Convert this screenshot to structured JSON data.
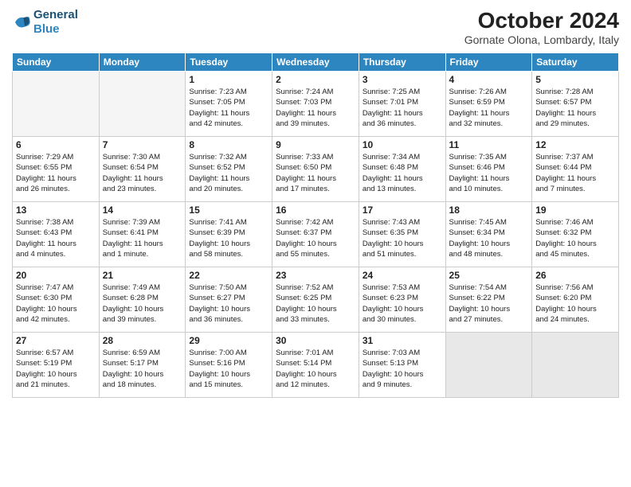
{
  "header": {
    "logo_line1": "General",
    "logo_line2": "Blue",
    "month": "October 2024",
    "location": "Gornate Olona, Lombardy, Italy"
  },
  "weekdays": [
    "Sunday",
    "Monday",
    "Tuesday",
    "Wednesday",
    "Thursday",
    "Friday",
    "Saturday"
  ],
  "weeks": [
    [
      {
        "day": "",
        "info": "",
        "empty": true
      },
      {
        "day": "",
        "info": "",
        "empty": true
      },
      {
        "day": "1",
        "info": "Sunrise: 7:23 AM\nSunset: 7:05 PM\nDaylight: 11 hours\nand 42 minutes."
      },
      {
        "day": "2",
        "info": "Sunrise: 7:24 AM\nSunset: 7:03 PM\nDaylight: 11 hours\nand 39 minutes."
      },
      {
        "day": "3",
        "info": "Sunrise: 7:25 AM\nSunset: 7:01 PM\nDaylight: 11 hours\nand 36 minutes."
      },
      {
        "day": "4",
        "info": "Sunrise: 7:26 AM\nSunset: 6:59 PM\nDaylight: 11 hours\nand 32 minutes."
      },
      {
        "day": "5",
        "info": "Sunrise: 7:28 AM\nSunset: 6:57 PM\nDaylight: 11 hours\nand 29 minutes."
      }
    ],
    [
      {
        "day": "6",
        "info": "Sunrise: 7:29 AM\nSunset: 6:55 PM\nDaylight: 11 hours\nand 26 minutes."
      },
      {
        "day": "7",
        "info": "Sunrise: 7:30 AM\nSunset: 6:54 PM\nDaylight: 11 hours\nand 23 minutes."
      },
      {
        "day": "8",
        "info": "Sunrise: 7:32 AM\nSunset: 6:52 PM\nDaylight: 11 hours\nand 20 minutes."
      },
      {
        "day": "9",
        "info": "Sunrise: 7:33 AM\nSunset: 6:50 PM\nDaylight: 11 hours\nand 17 minutes."
      },
      {
        "day": "10",
        "info": "Sunrise: 7:34 AM\nSunset: 6:48 PM\nDaylight: 11 hours\nand 13 minutes."
      },
      {
        "day": "11",
        "info": "Sunrise: 7:35 AM\nSunset: 6:46 PM\nDaylight: 11 hours\nand 10 minutes."
      },
      {
        "day": "12",
        "info": "Sunrise: 7:37 AM\nSunset: 6:44 PM\nDaylight: 11 hours\nand 7 minutes."
      }
    ],
    [
      {
        "day": "13",
        "info": "Sunrise: 7:38 AM\nSunset: 6:43 PM\nDaylight: 11 hours\nand 4 minutes."
      },
      {
        "day": "14",
        "info": "Sunrise: 7:39 AM\nSunset: 6:41 PM\nDaylight: 11 hours\nand 1 minute."
      },
      {
        "day": "15",
        "info": "Sunrise: 7:41 AM\nSunset: 6:39 PM\nDaylight: 10 hours\nand 58 minutes."
      },
      {
        "day": "16",
        "info": "Sunrise: 7:42 AM\nSunset: 6:37 PM\nDaylight: 10 hours\nand 55 minutes."
      },
      {
        "day": "17",
        "info": "Sunrise: 7:43 AM\nSunset: 6:35 PM\nDaylight: 10 hours\nand 51 minutes."
      },
      {
        "day": "18",
        "info": "Sunrise: 7:45 AM\nSunset: 6:34 PM\nDaylight: 10 hours\nand 48 minutes."
      },
      {
        "day": "19",
        "info": "Sunrise: 7:46 AM\nSunset: 6:32 PM\nDaylight: 10 hours\nand 45 minutes."
      }
    ],
    [
      {
        "day": "20",
        "info": "Sunrise: 7:47 AM\nSunset: 6:30 PM\nDaylight: 10 hours\nand 42 minutes."
      },
      {
        "day": "21",
        "info": "Sunrise: 7:49 AM\nSunset: 6:28 PM\nDaylight: 10 hours\nand 39 minutes."
      },
      {
        "day": "22",
        "info": "Sunrise: 7:50 AM\nSunset: 6:27 PM\nDaylight: 10 hours\nand 36 minutes."
      },
      {
        "day": "23",
        "info": "Sunrise: 7:52 AM\nSunset: 6:25 PM\nDaylight: 10 hours\nand 33 minutes."
      },
      {
        "day": "24",
        "info": "Sunrise: 7:53 AM\nSunset: 6:23 PM\nDaylight: 10 hours\nand 30 minutes."
      },
      {
        "day": "25",
        "info": "Sunrise: 7:54 AM\nSunset: 6:22 PM\nDaylight: 10 hours\nand 27 minutes."
      },
      {
        "day": "26",
        "info": "Sunrise: 7:56 AM\nSunset: 6:20 PM\nDaylight: 10 hours\nand 24 minutes."
      }
    ],
    [
      {
        "day": "27",
        "info": "Sunrise: 6:57 AM\nSunset: 5:19 PM\nDaylight: 10 hours\nand 21 minutes."
      },
      {
        "day": "28",
        "info": "Sunrise: 6:59 AM\nSunset: 5:17 PM\nDaylight: 10 hours\nand 18 minutes."
      },
      {
        "day": "29",
        "info": "Sunrise: 7:00 AM\nSunset: 5:16 PM\nDaylight: 10 hours\nand 15 minutes."
      },
      {
        "day": "30",
        "info": "Sunrise: 7:01 AM\nSunset: 5:14 PM\nDaylight: 10 hours\nand 12 minutes."
      },
      {
        "day": "31",
        "info": "Sunrise: 7:03 AM\nSunset: 5:13 PM\nDaylight: 10 hours\nand 9 minutes."
      },
      {
        "day": "",
        "info": "",
        "empty": true,
        "shaded": true
      },
      {
        "day": "",
        "info": "",
        "empty": true,
        "shaded": true
      }
    ]
  ]
}
